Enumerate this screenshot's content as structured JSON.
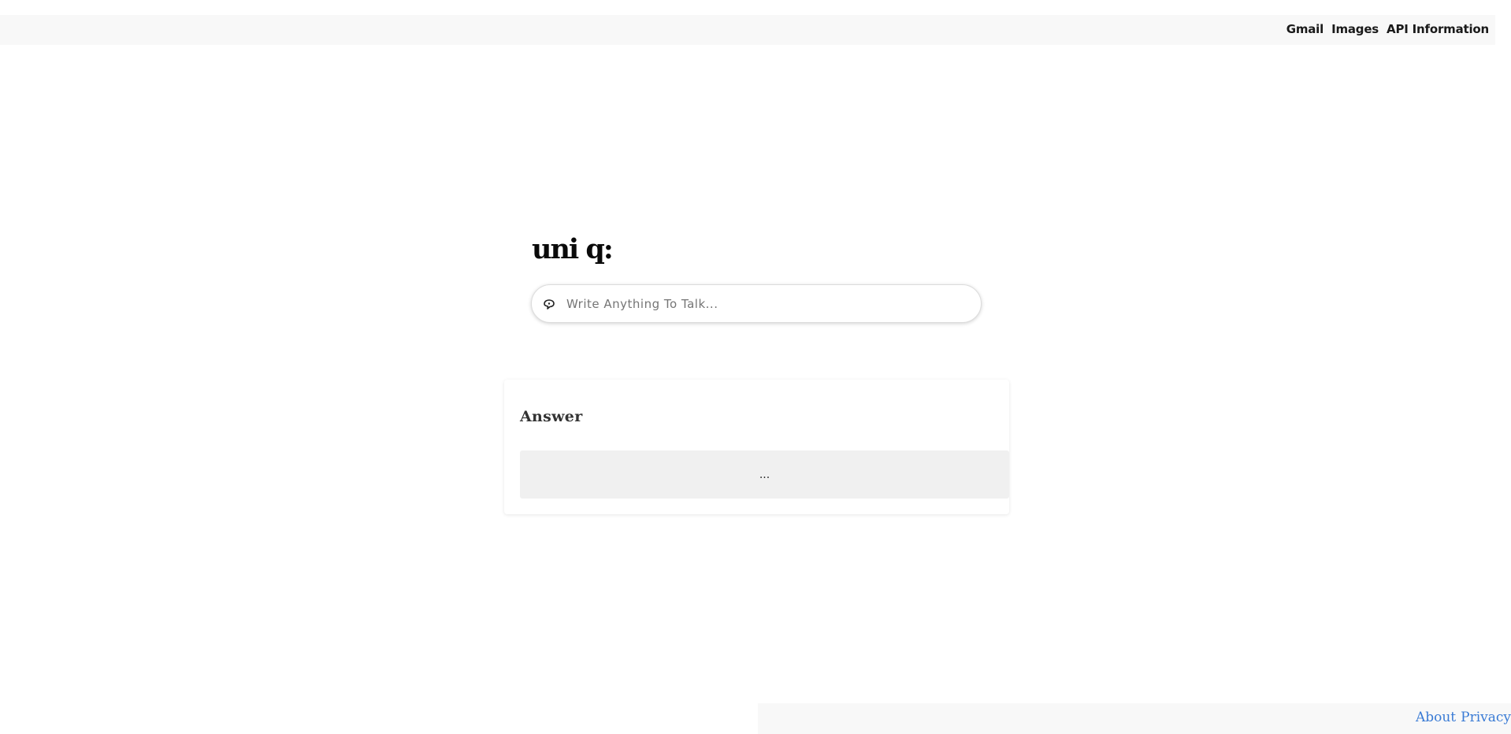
{
  "header": {
    "nav": [
      "Gmail",
      "Images",
      "API Information"
    ]
  },
  "logo": {
    "text": "uni q:"
  },
  "search": {
    "placeholder": "Write Anything To Talk...",
    "value": "",
    "icon": "chat-bubble-icon"
  },
  "answer": {
    "title": "Answer",
    "body": "..."
  },
  "footer": {
    "about_label": "About",
    "privacy_label": "Privacy"
  }
}
